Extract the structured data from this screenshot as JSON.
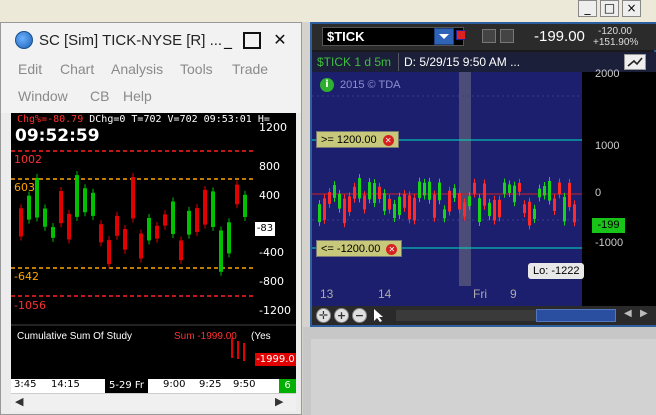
{
  "sc_window": {
    "title": "SC [Sim] TICK-NYSE [R] ...",
    "menu": [
      "Edit",
      "Chart",
      "Analysis",
      "Tools",
      "Trade",
      "Window",
      "CB",
      "Help"
    ],
    "status_line": "Chg%=-80.79 DChg=0 T=702 V=702 09:53:01 H=",
    "clock": "09:52:59",
    "price_levels": [
      "1200",
      "800",
      "400",
      "-400",
      "-800",
      "-1200"
    ],
    "current_value": "-83",
    "left_levels": [
      "1002",
      "603",
      "-642",
      "-1056"
    ],
    "study_label": "Cumulative Sum Of Study",
    "study_sum": "Sum -1999.00",
    "study_flag": "(Yes",
    "study_value_tag": "-1999.0",
    "time_labels": [
      "3:45",
      "14:15",
      "5-29 Fr",
      "9:00",
      "9:25",
      "9:50"
    ],
    "corner_value": "6",
    "colors": {
      "up": "#00c000",
      "down": "#e00000",
      "level_red": "#ff2020",
      "level_orange": "#ffa500"
    }
  },
  "tos_window": {
    "symbol": "$TICK",
    "price": "-199.00",
    "change_points": "-120.00",
    "change_pct": "+151.90%",
    "period": "$TICK 1 d 5m",
    "date_info": "D: 5/29/15 9:50 AM ...",
    "copyright": "2015 © TDA",
    "upper_alert": ">= 1200.00",
    "lower_alert": "<= -1200.00",
    "price_axis": [
      "2000",
      "1000",
      "0",
      "-1000"
    ],
    "last_tag": "-199",
    "low_label": "Lo: -1222",
    "x_labels": [
      "13",
      "14",
      "Fri",
      "9"
    ],
    "colors": {
      "background": "#1c1f6e",
      "up": "#19d319",
      "down": "#ff2a2a",
      "alert_line": "#00e0c0"
    }
  },
  "top_strip": {
    "buttons": [
      "_",
      "□",
      "×"
    ]
  }
}
